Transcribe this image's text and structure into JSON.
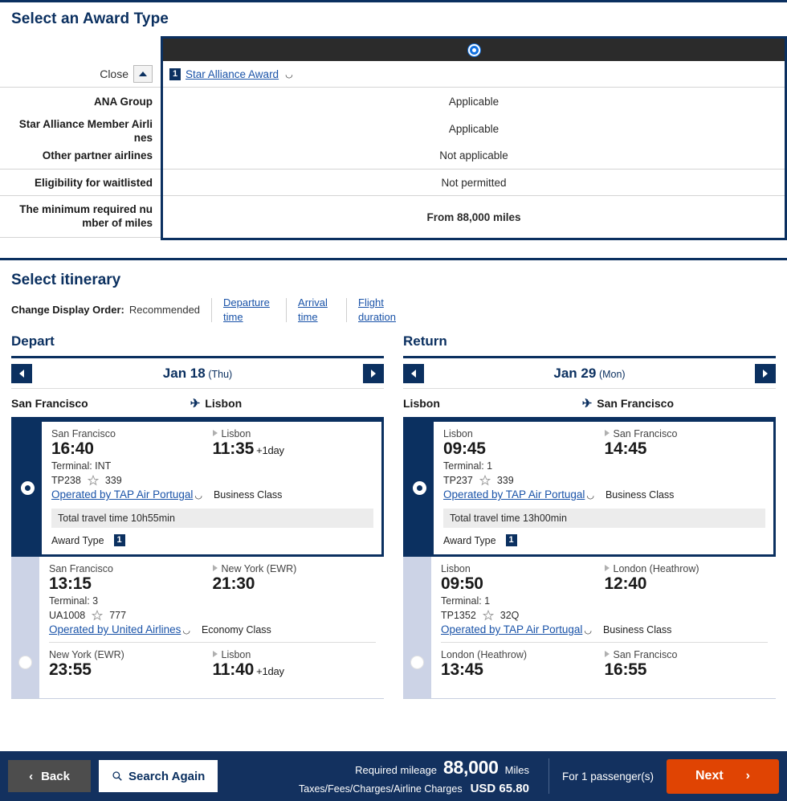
{
  "award": {
    "title": "Select an Award Type",
    "close_label": "Close",
    "close_icon": "caret-up-icon",
    "column_header": "Star Alliance Award",
    "column_badge": "1",
    "external_icon": "external-link-icon",
    "rows": [
      {
        "label": "ANA Group",
        "value": "Applicable"
      },
      {
        "label": "Star Alliance Member Airli nes",
        "value": "Applicable"
      },
      {
        "label": "Other partner airlines",
        "value": "Not applicable"
      },
      {
        "label": "Eligibility for waitlisted",
        "value": "Not permitted"
      },
      {
        "label": "The minimum required nu mber of miles",
        "value": "From 88,000 miles"
      }
    ]
  },
  "itinerary": {
    "title": "Select itinerary",
    "order_label": "Change Display Order:",
    "order_current": "Recommended",
    "order_links": [
      "Departure time",
      "Arrival time",
      "Flight duration"
    ],
    "columns": [
      {
        "title": "Depart",
        "date": "Jan 18",
        "day": "(Thu)",
        "origin": "San Francisco",
        "destination": "Lisbon",
        "plane_icon": "airplane-icon",
        "cards": [
          {
            "selected": true,
            "legs": [
              {
                "from": "San Francisco",
                "to": "Lisbon",
                "dep_time": "16:40",
                "arr_time": "11:35",
                "arr_plus": "+1day",
                "terminal": "Terminal: INT",
                "flight_no": "TP238",
                "aircraft": "339",
                "operator": "Operated by TAP Air Portugal",
                "cabin": "Business Class"
              }
            ],
            "travel_time": "Total travel time 10h55min",
            "award_label": "Award Type",
            "award_badge": "1"
          },
          {
            "selected": false,
            "legs": [
              {
                "from": "San Francisco",
                "to": "New York (EWR)",
                "dep_time": "13:15",
                "arr_time": "21:30",
                "arr_plus": "",
                "terminal": "Terminal: 3",
                "flight_no": "UA1008",
                "aircraft": "777",
                "operator": "Operated by United Airlines",
                "cabin": "Economy Class"
              },
              {
                "from": "New York (EWR)",
                "to": "Lisbon",
                "dep_time": "23:55",
                "arr_time": "11:40",
                "arr_plus": "+1day",
                "terminal": "",
                "flight_no": "",
                "aircraft": "",
                "operator": "",
                "cabin": ""
              }
            ],
            "travel_time": "",
            "award_label": "",
            "award_badge": ""
          }
        ]
      },
      {
        "title": "Return",
        "date": "Jan 29",
        "day": "(Mon)",
        "origin": "Lisbon",
        "destination": "San Francisco",
        "plane_icon": "airplane-icon",
        "cards": [
          {
            "selected": true,
            "legs": [
              {
                "from": "Lisbon",
                "to": "San Francisco",
                "dep_time": "09:45",
                "arr_time": "14:45",
                "arr_plus": "",
                "terminal": "Terminal: 1",
                "flight_no": "TP237",
                "aircraft": "339",
                "operator": "Operated by TAP Air Portugal",
                "cabin": "Business Class"
              }
            ],
            "travel_time": "Total travel time 13h00min",
            "award_label": "Award Type",
            "award_badge": "1"
          },
          {
            "selected": false,
            "legs": [
              {
                "from": "Lisbon",
                "to": "London (Heathrow)",
                "dep_time": "09:50",
                "arr_time": "12:40",
                "arr_plus": "",
                "terminal": "Terminal: 1",
                "flight_no": "TP1352",
                "aircraft": "32Q",
                "operator": "Operated by TAP Air Portugal",
                "cabin": "Business Class"
              },
              {
                "from": "London (Heathrow)",
                "to": "San Francisco",
                "dep_time": "13:45",
                "arr_time": "16:55",
                "arr_plus": "",
                "terminal": "",
                "flight_no": "",
                "aircraft": "",
                "operator": "",
                "cabin": ""
              }
            ],
            "travel_time": "",
            "award_label": "",
            "award_badge": ""
          }
        ]
      }
    ]
  },
  "footer": {
    "back_label": "Back",
    "back_icon": "chevron-left-icon",
    "search_label": "Search Again",
    "search_icon": "search-icon",
    "mileage_label": "Required mileage",
    "mileage_value": "88,000",
    "mileage_unit": "Miles",
    "tax_label": "Taxes/Fees/Charges/Airline Charges",
    "tax_value": "USD  65.80",
    "passenger_text": "For 1 passenger(s)",
    "next_label": "Next",
    "next_icon": "chevron-right-icon"
  },
  "colors": {
    "navy": "#0b3060",
    "footer_navy": "#13315f",
    "orange": "#e04403",
    "link_blue": "#1a53a8",
    "dark_bar": "#2b2b2b",
    "selected_radio_blue": "#1070e0"
  }
}
